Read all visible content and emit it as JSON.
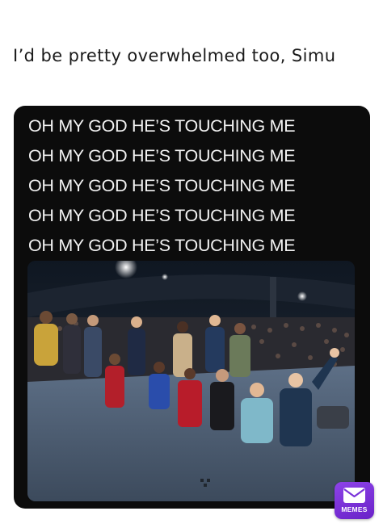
{
  "post": {
    "caption": "I’d be pretty overwhelmed too, Simu"
  },
  "meme": {
    "lines": [
      "OH MY GOD HE’S TOUCHING ME",
      "OH MY GOD HE’S TOUCHING ME",
      "OH MY GOD HE’S TOUCHING ME",
      "OH MY GOD HE’S TOUCHING ME",
      "OH MY GOD HE’S TOUCHING ME"
    ]
  },
  "badge": {
    "label": "MEMES",
    "color": "#7a33d9",
    "icon": "envelope-icon"
  }
}
